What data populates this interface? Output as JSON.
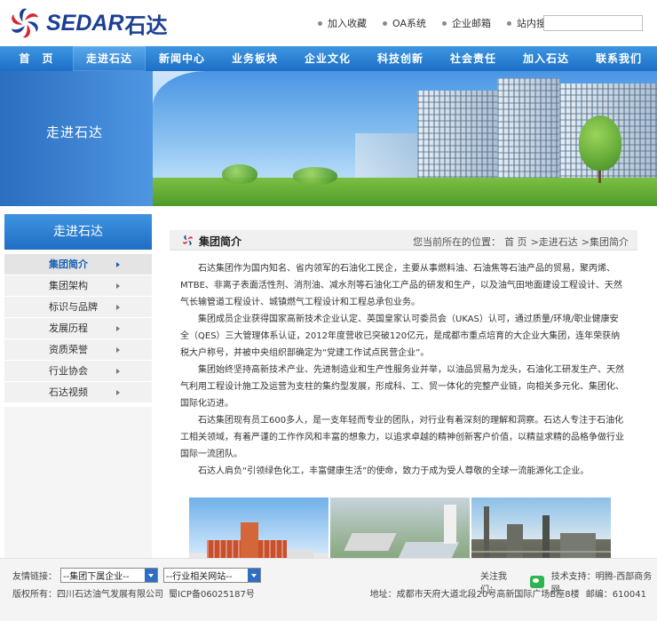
{
  "brand": {
    "logo_text": "SEDAR",
    "logo_cn": "石达"
  },
  "top_links": [
    "加入收藏",
    "OA系统",
    "企业邮箱",
    "站内搜索"
  ],
  "nav": [
    "首　页",
    "走进石达",
    "新闻中心",
    "业务板块",
    "企业文化",
    "科技创新",
    "社会责任",
    "加入石达",
    "联系我们"
  ],
  "nav_active_index": 1,
  "banner": {
    "title": "走进石达"
  },
  "sidebar": {
    "title": "走进石达",
    "items": [
      "集团简介",
      "集团架构",
      "标识与品牌",
      "发展历程",
      "资质荣誉",
      "行业协会",
      "石达视频"
    ],
    "active_index": 0
  },
  "main": {
    "title": "集团简介",
    "breadcrumb_prefix": "您当前所在的位置：",
    "breadcrumb": [
      "首 页",
      ">走进石达",
      ">集团简介"
    ],
    "paragraphs": [
      "石达集团作为国内知名、省内领军的石油化工民企，主要从事燃料油、石油焦等石油产品的贸易，聚丙烯、MTBE、非离子表面活性剂、消剂油、减水剂等石油化工产品的研发和生产，以及油气田地面建设工程设计、天然气长输管道工程设计、城镇燃气工程设计和工程总承包业务。",
      "集团成员企业获得国家高新技术企业认定、英国皇家认可委员会（UKAS）认可，通过质量/环境/职业健康安全（QES）三大管理体系认证，2012年度营收已突破120亿元，是成都市重点培育的大企业大集团，连年荣获纳税大户称号，并被中央组织部确定为“党建工作试点民营企业”。",
      "集团始终坚持高新技术产业、先进制造业和生产性服务业并举，以油品贸易为龙头，石油化工研发生产、天然气利用工程设计施工及运营为支柱的集约型发展，形成科、工、贸一体化的完整产业链，向相关多元化、集团化、国际化迈进。",
      "石达集团现有员工600多人，是一支年轻而专业的团队，对行业有着深刻的理解和洞察。石达人专注于石油化工相关领域，有着严谨的工作作风和丰富的想象力，以追求卓越的精神创新客户价值，以精益求精的品格争做行业国际一流团队。",
      "石达人肩负“引领绿色化工，丰富健康生活”的使命，致力于成为受人尊敬的全球一流能源化工企业。"
    ]
  },
  "footer": {
    "links_label": "友情链接：",
    "select_1": "--集团下属企业--",
    "select_2": "--行业相关网站--",
    "copyright": "版权所有：四川石达油气发展有限公司",
    "icp": "蜀ICP备06025187号",
    "follow_label": "关注我们：",
    "tech_support": "技术支持：明腾-西部商务网",
    "address": "地址：成都市天府大道北段20号高新国际广场B座8楼",
    "postcode": "邮编：610041"
  },
  "colors": {
    "brand_blue": "#1c3f94",
    "nav_blue": "#1d6fc6",
    "logo_red": "#d9262c"
  }
}
